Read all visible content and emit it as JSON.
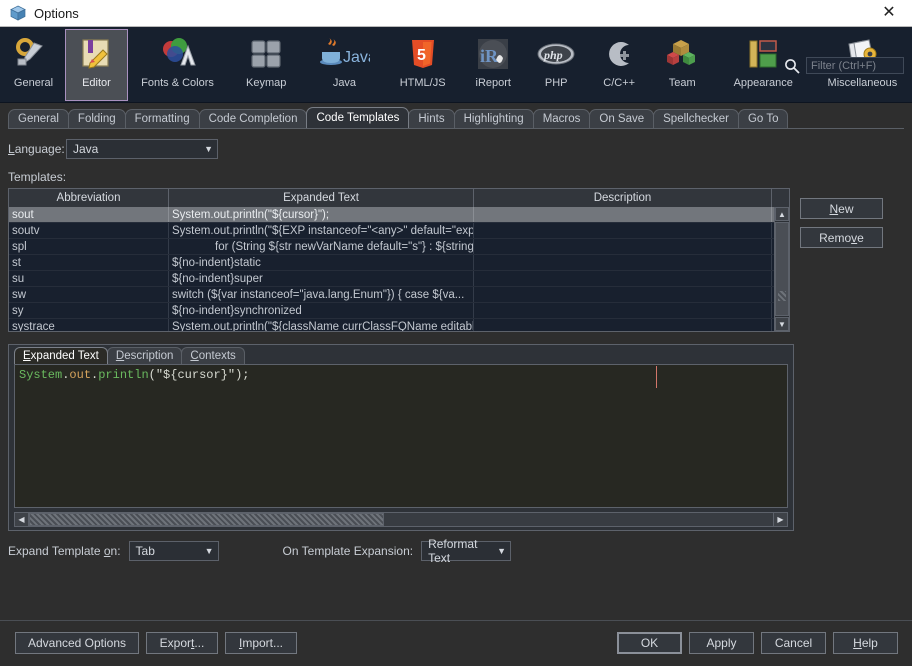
{
  "window": {
    "title": "Options",
    "icon": "cube-icon",
    "close_label": "✕"
  },
  "toolbar": {
    "categories": [
      {
        "label": "General",
        "icon": "gear-wrench-icon",
        "selected": false
      },
      {
        "label": "Editor",
        "icon": "editor-pencil-icon",
        "selected": true
      },
      {
        "label": "Fonts & Colors",
        "icon": "fonts-colors-icon",
        "selected": false
      },
      {
        "label": "Keymap",
        "icon": "keyboard-keys-icon",
        "selected": false
      },
      {
        "label": "Java",
        "icon": "java-coffee-icon",
        "selected": false
      },
      {
        "label": "HTML/JS",
        "icon": "html5-shield-icon",
        "selected": false
      },
      {
        "label": "iReport",
        "icon": "ireport-icon",
        "selected": false
      },
      {
        "label": "PHP",
        "icon": "php-icon",
        "selected": false
      },
      {
        "label": "C/C++",
        "icon": "c-cpp-icon",
        "selected": false
      },
      {
        "label": "Team",
        "icon": "team-cubes-icon",
        "selected": false
      },
      {
        "label": "Appearance",
        "icon": "appearance-panels-icon",
        "selected": false
      },
      {
        "label": "Miscellaneous",
        "icon": "miscellaneous-gear-folder-icon",
        "selected": false
      }
    ],
    "filter": {
      "placeholder": "Filter (Ctrl+F)",
      "value": "",
      "icon": "search-icon"
    }
  },
  "tabs": [
    {
      "label": "General",
      "active": false
    },
    {
      "label": "Folding",
      "active": false
    },
    {
      "label": "Formatting",
      "active": false
    },
    {
      "label": "Code Completion",
      "active": false
    },
    {
      "label": "Code Templates",
      "active": true
    },
    {
      "label": "Hints",
      "active": false
    },
    {
      "label": "Highlighting",
      "active": false
    },
    {
      "label": "Macros",
      "active": false
    },
    {
      "label": "On Save",
      "active": false
    },
    {
      "label": "Spellchecker",
      "active": false
    },
    {
      "label": "Go To",
      "active": false
    }
  ],
  "form": {
    "language_label": "Language:",
    "language_value": "Java",
    "templates_label": "Templates:"
  },
  "table": {
    "columns": [
      "Abbreviation",
      "Expanded Text",
      "Description"
    ],
    "rows": [
      {
        "abbr": "sout",
        "expanded": "System.out.println(\"${cursor}\");",
        "desc": "",
        "selected": true,
        "indent": false
      },
      {
        "abbr": "soutv",
        "expanded": "System.out.println(\"${EXP instanceof=\"<any>\" default=\"exp\"}...",
        "desc": "",
        "selected": false,
        "indent": false
      },
      {
        "abbr": "spl",
        "expanded": "for (String ${str newVarName default=\"s\"} : ${string ins...",
        "desc": "",
        "selected": false,
        "indent": true
      },
      {
        "abbr": "st",
        "expanded": "${no-indent}static",
        "desc": "",
        "selected": false,
        "indent": false
      },
      {
        "abbr": "su",
        "expanded": "${no-indent}super",
        "desc": "",
        "selected": false,
        "indent": false
      },
      {
        "abbr": "sw",
        "expanded": "switch (${var instanceof=\"java.lang.Enum\"}) {          case ${va...",
        "desc": "",
        "selected": false,
        "indent": false
      },
      {
        "abbr": "sy",
        "expanded": "${no-indent}synchronized",
        "desc": "",
        "selected": false,
        "indent": false
      },
      {
        "abbr": "systrace",
        "expanded": "System.out.println(\"${className currClassFQName editable=...",
        "desc": "",
        "selected": false,
        "indent": false
      }
    ],
    "side_buttons": [
      {
        "label": "New",
        "mnemonic_index": 1
      },
      {
        "label": "Remove",
        "mnemonic_index": 4
      }
    ],
    "scroll_up_glyph": "▲",
    "scroll_down_glyph": "▼"
  },
  "detail": {
    "tabs": [
      {
        "label": "Expanded Text",
        "active": true
      },
      {
        "label": "Description",
        "active": false
      },
      {
        "label": "Contexts",
        "active": false
      }
    ],
    "code": {
      "tokens": [
        {
          "text": "System",
          "kind": "class"
        },
        {
          "text": ".",
          "kind": "plain"
        },
        {
          "text": "out",
          "kind": "field"
        },
        {
          "text": ".",
          "kind": "plain"
        },
        {
          "text": "println",
          "kind": "class"
        },
        {
          "text": "(\"${cursor}\");",
          "kind": "plain"
        }
      ],
      "full_text": "System.out.println(\"${cursor}\");"
    },
    "scroll_left_glyph": "◀",
    "scroll_right_glyph": "▶"
  },
  "options": {
    "expand_label": "Expand Template on:",
    "expand_value": "Tab",
    "on_expansion_label": "On Template Expansion:",
    "on_expansion_value": "Reformat Text"
  },
  "footer": {
    "left_buttons": [
      {
        "label": "Advanced Options"
      },
      {
        "label": "Export..."
      },
      {
        "label": "Import..."
      }
    ],
    "right_buttons": [
      {
        "label": "OK",
        "default": true
      },
      {
        "label": "Apply",
        "default": false
      },
      {
        "label": "Cancel",
        "default": false
      },
      {
        "label": "Help",
        "default": false
      }
    ]
  },
  "colors": {
    "toolbar_bg": "#17202e",
    "panel_bg": "#2e2e2e",
    "table_bg": "#18202e",
    "selection_bg": "#72767c",
    "editor_bg": "#272822",
    "accent_selected_border": "#a991bf",
    "code_class": "#6aba5f",
    "code_field": "#d6a35c",
    "code_plain": "#d8dbd2",
    "margin_guide": "#d2766a"
  }
}
